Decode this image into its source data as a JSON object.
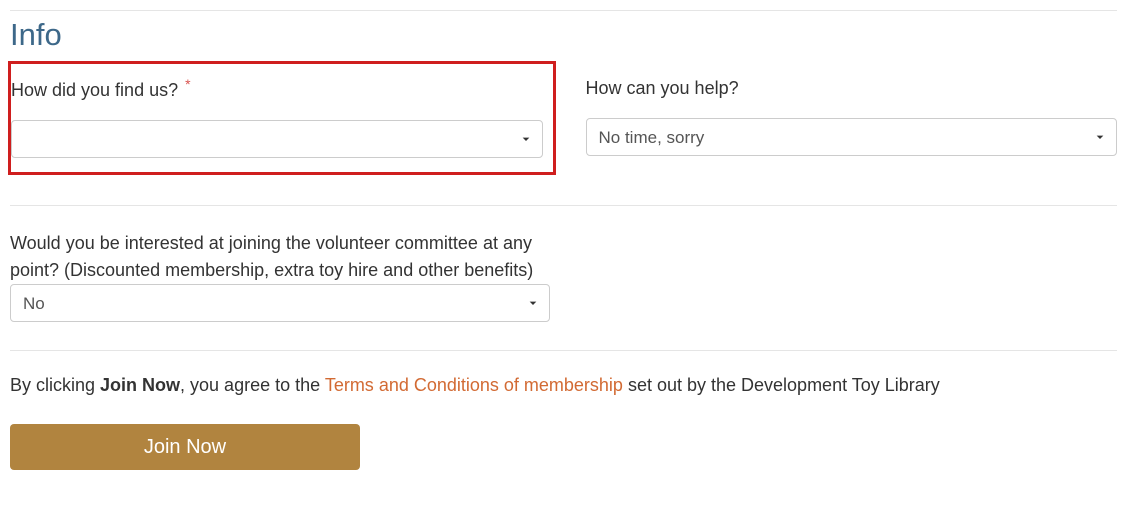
{
  "section": {
    "title": "Info"
  },
  "fields": {
    "find_us": {
      "label": "How did you find us?",
      "required_mark": "*",
      "value": ""
    },
    "help": {
      "label": "How can you help?",
      "value": "No time, sorry"
    },
    "volunteer": {
      "label": "Would you be interested at joining the volunteer committee at any point? (Discounted membership, extra toy hire and other benefits)",
      "value": "No"
    }
  },
  "agreement": {
    "prefix": "By clicking ",
    "bold": "Join Now",
    "middle": ", you agree to the ",
    "link": "Terms and Conditions of membership",
    "suffix": " set out by the Development Toy Library"
  },
  "submit": {
    "label": "Join Now"
  }
}
